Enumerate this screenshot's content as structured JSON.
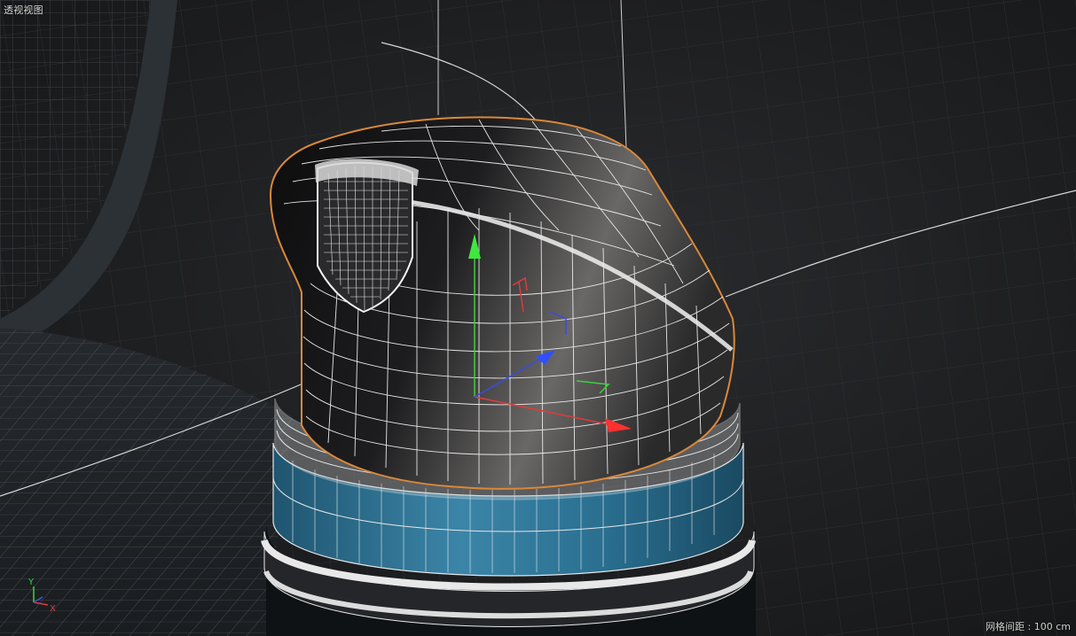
{
  "viewport": {
    "title": "透视视图",
    "grid_spacing_label": "网格间距 : 100 cm"
  },
  "axis_widget": {
    "y_label": "Y",
    "x_label": "X",
    "y_color": "#38d838",
    "x_color": "#e03a3a",
    "z_color": "#3a5ae0"
  },
  "scene": {
    "object_icon": "cylinder-bottle-cap-mesh",
    "selection_outline_color": "#d9883a",
    "wireframe_color": "#f2f2f2",
    "body_band_color": "#2e6f8e"
  }
}
